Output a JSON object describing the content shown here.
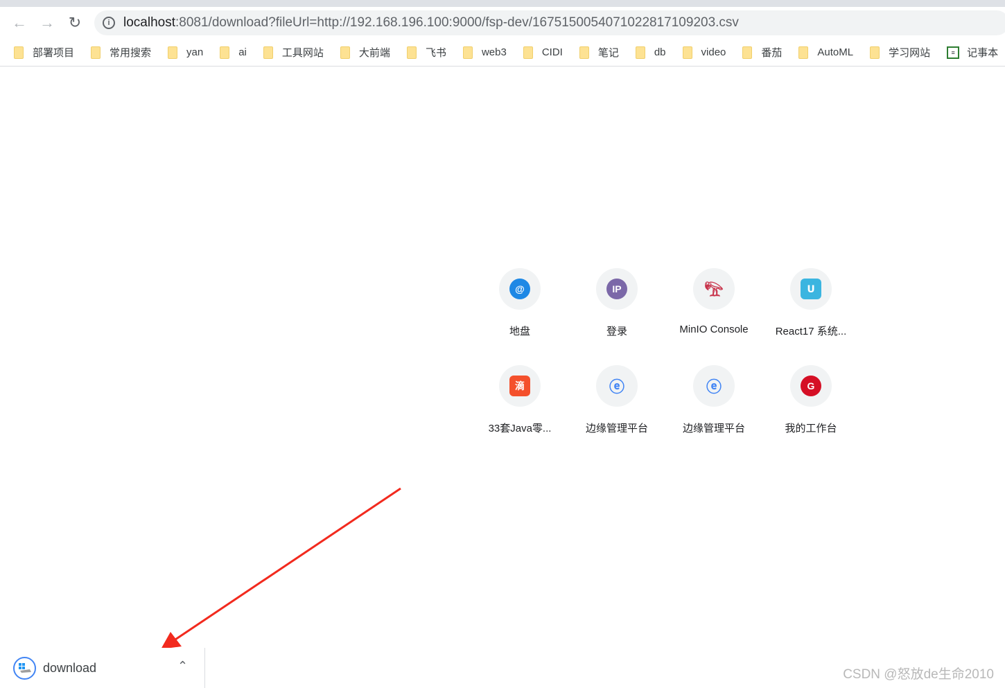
{
  "browser": {
    "url_host": "localhost",
    "url_rest": ":8081/download?fileUrl=http://192.168.196.100:9000/fsp-dev/167515005407102281710920​3.csv",
    "bookmarks": [
      {
        "label": "部署项目",
        "icon": "folder-icon"
      },
      {
        "label": "常用搜索",
        "icon": "folder-icon"
      },
      {
        "label": "yan",
        "icon": "folder-icon"
      },
      {
        "label": "ai",
        "icon": "folder-icon"
      },
      {
        "label": "工具网站",
        "icon": "folder-icon"
      },
      {
        "label": "大前端",
        "icon": "folder-icon"
      },
      {
        "label": "飞书",
        "icon": "folder-icon"
      },
      {
        "label": "web3",
        "icon": "folder-icon"
      },
      {
        "label": "CIDI",
        "icon": "folder-icon"
      },
      {
        "label": "笔记",
        "icon": "folder-icon"
      },
      {
        "label": "db",
        "icon": "folder-icon"
      },
      {
        "label": "video",
        "icon": "folder-icon"
      },
      {
        "label": "番茄",
        "icon": "folder-icon"
      },
      {
        "label": "AutoML",
        "icon": "folder-icon"
      },
      {
        "label": "学习网站",
        "icon": "folder-icon"
      },
      {
        "label": "记事本",
        "icon": "notepad-icon"
      }
    ]
  },
  "shortcuts": [
    {
      "label": "地盘",
      "icon": "swirl-icon",
      "color": "#1e88e5"
    },
    {
      "label": "登录",
      "icon": "ip-icon",
      "color": "#7b68a8",
      "glyph": "IP"
    },
    {
      "label": "MinIO Console",
      "icon": "flamingo-icon",
      "color": "#c8324a"
    },
    {
      "label": "React17 系统...",
      "icon": "smile-icon",
      "color": "#3bb5e0"
    },
    {
      "label": "33套Java零...",
      "icon": "di-icon",
      "color": "#f4502c",
      "glyph": "滴"
    },
    {
      "label": "边缘管理平台",
      "icon": "edge-logo-icon",
      "color": "#4285f4"
    },
    {
      "label": "边缘管理平台",
      "icon": "edge-logo-icon",
      "color": "#4285f4"
    },
    {
      "label": "我的工作台",
      "icon": "g-logo-icon",
      "color": "#d50f25"
    }
  ],
  "download": {
    "filename": "download"
  },
  "watermark": "CSDN @怒放de生命2010",
  "annotation_color": "#f22a1e"
}
